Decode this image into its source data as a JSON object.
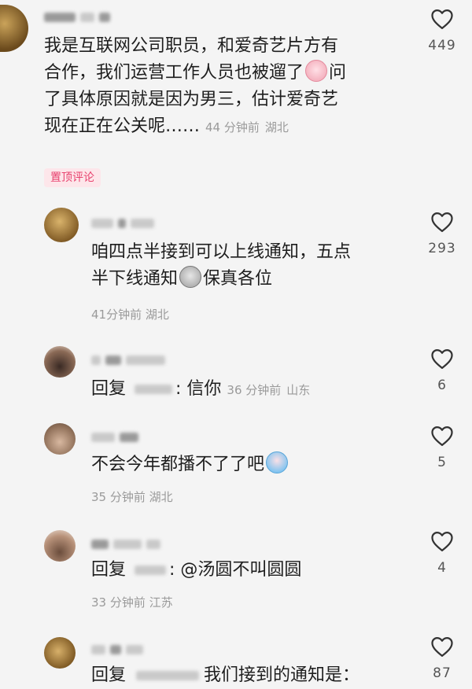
{
  "comments": [
    {
      "text_lines": [
        "我是互联网公司职员，和爱奇艺片方有",
        "合作，我们运营工作人员也被遛了",
        "了具体原因就是因为男三，估计爱奇艺",
        "现在正在公关呢……"
      ],
      "line2_after_emoji": "问",
      "time": "44 分钟前",
      "location": "湖北",
      "likes": "449",
      "badge": "置顶评论"
    },
    {
      "text_lines": [
        "咱四点半接到可以上线通知，五点",
        "半下线通知"
      ],
      "line2_after_emoji": "保真各位",
      "time": "41分钟前",
      "location": "湖北",
      "likes": "293"
    },
    {
      "reply_prefix": "回复",
      "reply_body": ": 信你",
      "time": "36 分钟前",
      "location": "山东",
      "likes": "6"
    },
    {
      "text": "不会今年都播不了了吧",
      "time": "35 分钟前",
      "location": "湖北",
      "likes": "5"
    },
    {
      "reply_prefix": "回复",
      "reply_body": ": @汤圆不叫圆圆",
      "time": "33 分钟前",
      "location": "江苏",
      "likes": "4"
    },
    {
      "reply_prefix": "回复",
      "reply_body": "我们接到的通知是：",
      "likes": "87"
    }
  ],
  "colors": {
    "badge_bg": "#fde6ea",
    "badge_text": "#e8426e",
    "meta": "#9a9a9a",
    "heart": "#333333"
  },
  "icons": {
    "like": "heart-outline-icon",
    "emoji_cry": "crying-face-emoji",
    "emoji_sweat": "sweat-face-emoji",
    "emoji_sob": "sobbing-face-emoji"
  }
}
